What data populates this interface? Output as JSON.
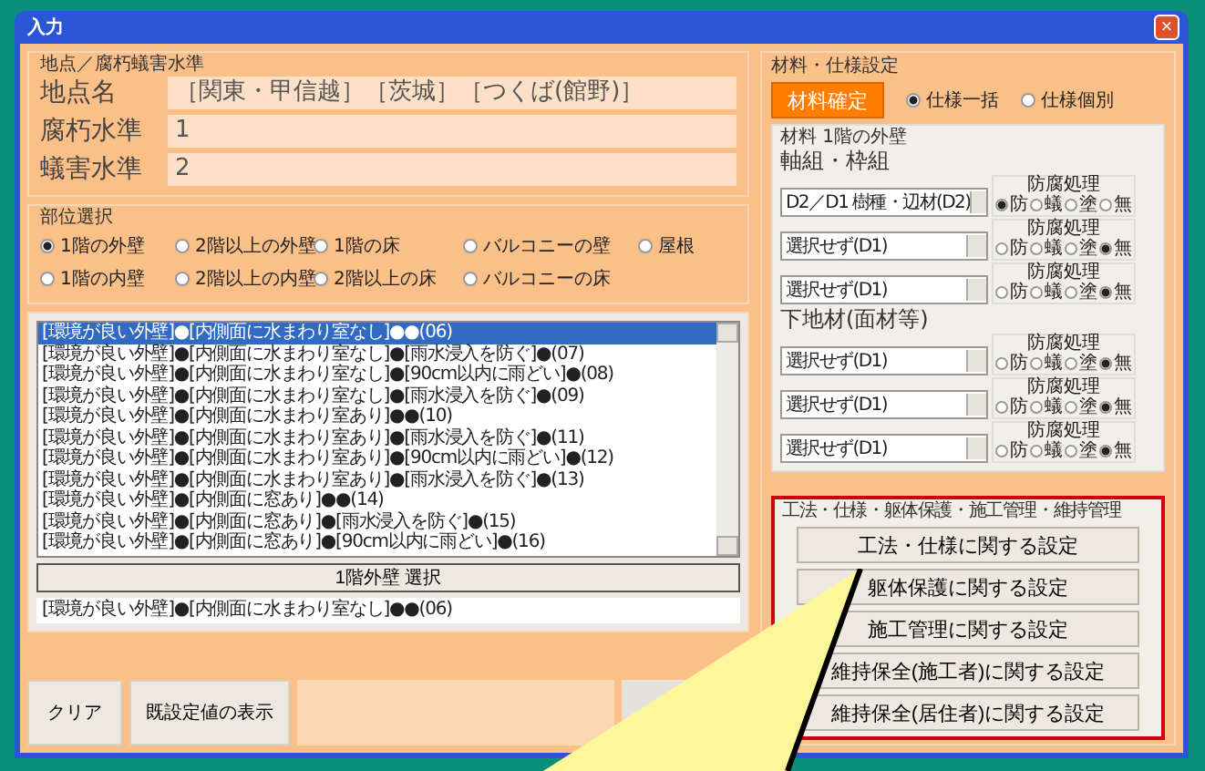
{
  "window": {
    "title": "入力",
    "close": "×"
  },
  "location": {
    "legend": "地点／腐朽蟻害水準",
    "fields": [
      {
        "label": "地点名",
        "value": "［関東・甲信越］［茨城］［つくば(館野)］"
      },
      {
        "label": "腐朽水準",
        "value": "1"
      },
      {
        "label": "蟻害水準",
        "value": "2"
      }
    ]
  },
  "parts": {
    "legend": "部位選択",
    "options": [
      {
        "label": "1階の外壁",
        "selected": true
      },
      {
        "label": "2階以上の外壁",
        "selected": false
      },
      {
        "label": "1階の床",
        "selected": false
      },
      {
        "label": "バルコニーの壁",
        "selected": false
      },
      {
        "label": "屋根",
        "selected": false
      },
      {
        "label": "1階の内壁",
        "selected": false
      },
      {
        "label": "2階以上の内壁",
        "selected": false
      },
      {
        "label": "2階以上の床",
        "selected": false
      },
      {
        "label": "バルコニーの床",
        "selected": false
      }
    ]
  },
  "list": {
    "rows": [
      {
        "text": "[環境が良い外壁]●[内側面に水まわり室なし]●●(06)",
        "selected": true
      },
      {
        "text": "[環境が良い外壁]●[内側面に水まわり室なし]●[雨水浸入を防ぐ]●(07)",
        "selected": false
      },
      {
        "text": "[環境が良い外壁]●[内側面に水まわり室なし]●[90cm以内に雨どい]●(08)",
        "selected": false
      },
      {
        "text": "[環境が良い外壁]●[内側面に水まわり室なし]●[雨水浸入を防ぐ]●(09)",
        "selected": false
      },
      {
        "text": "[環境が良い外壁]●[内側面に水まわり室あり]●●(10)",
        "selected": false
      },
      {
        "text": "[環境が良い外壁]●[内側面に水まわり室あり]●[雨水浸入を防ぐ]●(11)",
        "selected": false
      },
      {
        "text": "[環境が良い外壁]●[内側面に水まわり室あり]●[90cm以内に雨どい]●(12)",
        "selected": false
      },
      {
        "text": "[環境が良い外壁]●[内側面に水まわり室あり]●[雨水浸入を防ぐ]●(13)",
        "selected": false
      },
      {
        "text": "[環境が良い外壁]●[内側面に窓あり]●●(14)",
        "selected": false
      },
      {
        "text": "[環境が良い外壁]●[内側面に窓あり]●[雨水浸入を防ぐ]●(15)",
        "selected": false
      },
      {
        "text": "[環境が良い外壁]●[内側面に窓あり]●[90cm以内に雨どい]●(16)",
        "selected": false
      }
    ],
    "select_button": "1階外壁  選択",
    "result": "[環境が良い外壁]●[内側面に水まわり室なし]●●(06)"
  },
  "bottom_buttons": [
    "クリア",
    "既設定値の表示"
  ],
  "material": {
    "legend": "材料・仕様設定",
    "confirm": "材料確定",
    "modes": [
      {
        "label": "仕様一括",
        "selected": true
      },
      {
        "label": "仕様個別",
        "selected": false
      }
    ],
    "group_legend": "材料  1階の外壁",
    "sections": [
      {
        "title": "軸組・枠組",
        "rows": [
          {
            "value": "D2／D1 樹種・辺材(D2)",
            "treatment_label": "防腐処理",
            "options": [
              {
                "label": "防",
                "selected": true
              },
              {
                "label": "蟻",
                "selected": false
              },
              {
                "label": "塗",
                "selected": false
              },
              {
                "label": "無",
                "selected": false
              }
            ]
          },
          {
            "value": "選択せず(D1)",
            "treatment_label": "防腐処理",
            "options": [
              {
                "label": "防",
                "selected": false
              },
              {
                "label": "蟻",
                "selected": false
              },
              {
                "label": "塗",
                "selected": false
              },
              {
                "label": "無",
                "selected": true
              }
            ]
          },
          {
            "value": "選択せず(D1)",
            "treatment_label": "防腐処理",
            "options": [
              {
                "label": "防",
                "selected": false
              },
              {
                "label": "蟻",
                "selected": false
              },
              {
                "label": "塗",
                "selected": false
              },
              {
                "label": "無",
                "selected": true
              }
            ]
          }
        ]
      },
      {
        "title": "下地材(面材等)",
        "rows": [
          {
            "value": "選択せず(D1)",
            "treatment_label": "防腐処理",
            "options": [
              {
                "label": "防",
                "selected": false
              },
              {
                "label": "蟻",
                "selected": false
              },
              {
                "label": "塗",
                "selected": false
              },
              {
                "label": "無",
                "selected": true
              }
            ]
          },
          {
            "value": "選択せず(D1)",
            "treatment_label": "防腐処理",
            "options": [
              {
                "label": "防",
                "selected": false
              },
              {
                "label": "蟻",
                "selected": false
              },
              {
                "label": "塗",
                "selected": false
              },
              {
                "label": "無",
                "selected": true
              }
            ]
          },
          {
            "value": "選択せず(D1)",
            "treatment_label": "防腐処理",
            "options": [
              {
                "label": "防",
                "selected": false
              },
              {
                "label": "蟻",
                "selected": false
              },
              {
                "label": "塗",
                "selected": false
              },
              {
                "label": "無",
                "selected": true
              }
            ]
          }
        ]
      }
    ]
  },
  "management": {
    "legend": "工法・仕様・躯体保護・施工管理・維持管理",
    "buttons": [
      "工法・仕様に関する設定",
      "躯体保護に関する設定",
      "施工管理に関する設定",
      "維持保全(施工者)に関する設定",
      "維持保全(居住者)に関する設定"
    ]
  }
}
